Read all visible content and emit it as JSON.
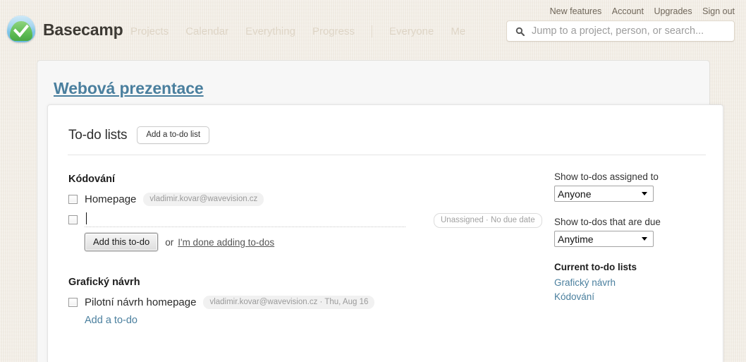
{
  "topbar": {
    "brand": "Basecamp",
    "logo_icon": "basecamp-logo-icon",
    "account_links": [
      {
        "label": "New features"
      },
      {
        "label": "Account"
      },
      {
        "label": "Upgrades"
      },
      {
        "label": "Sign out"
      }
    ],
    "nav": [
      {
        "label": "Projects"
      },
      {
        "label": "Calendar"
      },
      {
        "label": "Everything"
      },
      {
        "label": "Progress"
      },
      {
        "label": "Everyone"
      },
      {
        "label": "Me"
      }
    ],
    "search": {
      "icon": "search-icon",
      "placeholder": "Jump to a project, person, or search...",
      "value": ""
    }
  },
  "project": {
    "title": "Webová prezentace"
  },
  "card": {
    "heading": "To-do lists",
    "add_list_label": "Add a to-do list"
  },
  "lists": [
    {
      "name": "Kódování",
      "todos": [
        {
          "text": "Homepage",
          "meta": "vladimir.kovar@wavevision.cz",
          "checked": false
        }
      ],
      "new_todo": {
        "value": "",
        "placeholder": "",
        "meta": "Unassigned · No due date",
        "submit_label": "Add this to-do",
        "or_label": "or",
        "done_label": "I'm done adding to-dos"
      }
    },
    {
      "name": "Grafický návrh",
      "todos": [
        {
          "text": "Pilotní návrh homepage",
          "meta": "vladimir.kovar@wavevision.cz · Thu, Aug 16",
          "checked": false
        }
      ],
      "add_todo_label": "Add a to-do"
    }
  ],
  "sidebar": {
    "assigned_label": "Show to-dos assigned to",
    "assigned_value": "Anyone",
    "due_label": "Show to-dos that are due",
    "due_value": "Anytime",
    "current_lists_heading": "Current to-do lists",
    "current_lists": [
      {
        "label": "Grafický návrh"
      },
      {
        "label": "Kódování"
      }
    ]
  },
  "colors": {
    "link_blue": "#4a7f9e",
    "page_bg": "#f2ece2",
    "brand_dark": "#3d3a34"
  }
}
